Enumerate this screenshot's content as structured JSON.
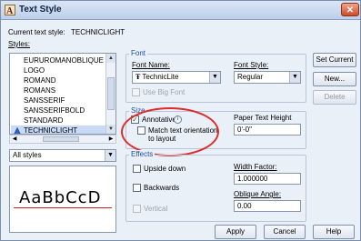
{
  "window": {
    "title": "Text Style",
    "close_glyph": "✕"
  },
  "current_style": {
    "label": "Current text style:",
    "value": "TECHNICLIGHT"
  },
  "styles": {
    "label": "Styles:",
    "items": [
      {
        "name": "EURUROMANOBLIQUE",
        "selected": false
      },
      {
        "name": "LOGO",
        "selected": false
      },
      {
        "name": "ROMAND",
        "selected": false
      },
      {
        "name": "ROMANS",
        "selected": false
      },
      {
        "name": "SANSSERIF",
        "selected": false
      },
      {
        "name": "SANSSERIFBOLD",
        "selected": false
      },
      {
        "name": "STANDARD",
        "selected": false
      },
      {
        "name": "TECHNICLIGHT",
        "selected": true,
        "icon": "annotative-icon"
      }
    ],
    "filter": "All styles"
  },
  "preview": {
    "text": "AaBbCcD"
  },
  "font": {
    "group": "Font",
    "name_label": "Font Name:",
    "name_value": "TechnicLite",
    "style_label": "Font Style:",
    "style_value": "Regular",
    "big_font_label": "Use Big Font"
  },
  "size": {
    "group": "Size",
    "annotative_label": "Annotative",
    "annotative_checked": true,
    "match_line1": "Match text orientation",
    "match_line2": "to layout",
    "paper_height_label": "Paper Text Height",
    "paper_height_value": "0'-0\""
  },
  "effects": {
    "group": "Effects",
    "upside_down": "Upside down",
    "backwards": "Backwards",
    "vertical": "Vertical",
    "width_factor_label": "Width Factor:",
    "width_factor_value": "1.000000",
    "oblique_label": "Oblique Angle:",
    "oblique_value": "0.00"
  },
  "buttons": {
    "set_current": "Set Current",
    "new": "New...",
    "delete": "Delete",
    "apply": "Apply",
    "cancel": "Cancel",
    "help": "Help"
  },
  "colors": {
    "annotation_circle": "#e02b2b",
    "preview_baseline": "#d42020",
    "group_title": "#1f4ea0"
  }
}
